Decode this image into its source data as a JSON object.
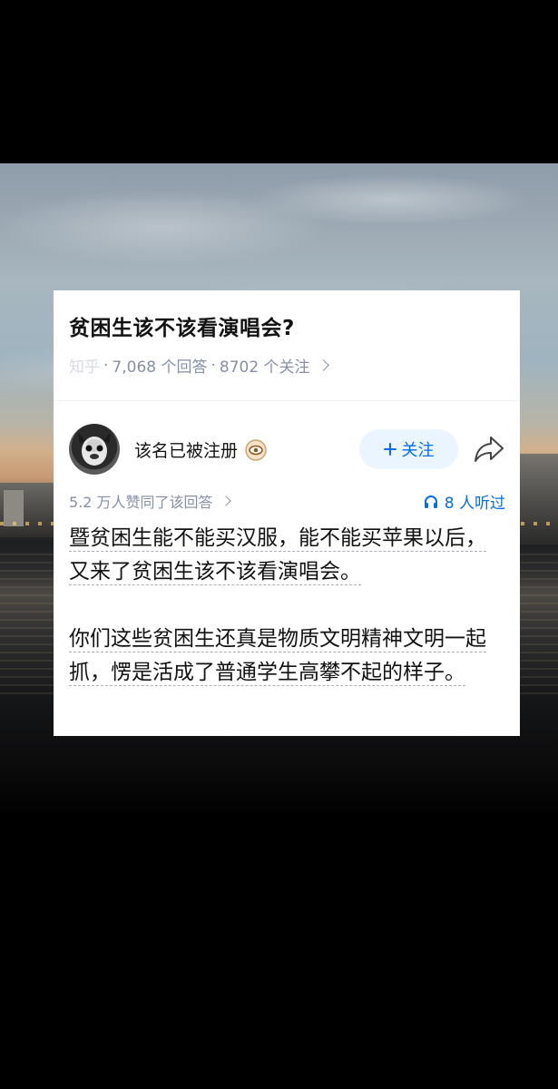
{
  "question": {
    "title": "贫困生该不该看演唱会?",
    "source_faded": "知乎",
    "answers": "7,068 个回答",
    "followers": "8702 个关注"
  },
  "answer": {
    "author": "该名已被注册",
    "follow_label": "关注",
    "likes_text": "5.2 万人赞同了该回答",
    "listen_text": "8 人听过",
    "paragraphs": [
      "暨贫困生能不能买汉服，能不能买苹果以后，又来了贫困生该不该看演唱会。",
      "你们这些贫困生还真是物质文明精神文明一起抓，愣是活成了普通学生高攀不起的样子。"
    ]
  },
  "colors": {
    "accent": "#056de8",
    "follow_bg": "#ebf5ff",
    "meta_gray": "#8590a6",
    "text": "#121212"
  },
  "icons": [
    "avatar",
    "badge-eye-icon",
    "plus-icon",
    "share-icon",
    "headphones-icon",
    "chevron-right-icon"
  ]
}
